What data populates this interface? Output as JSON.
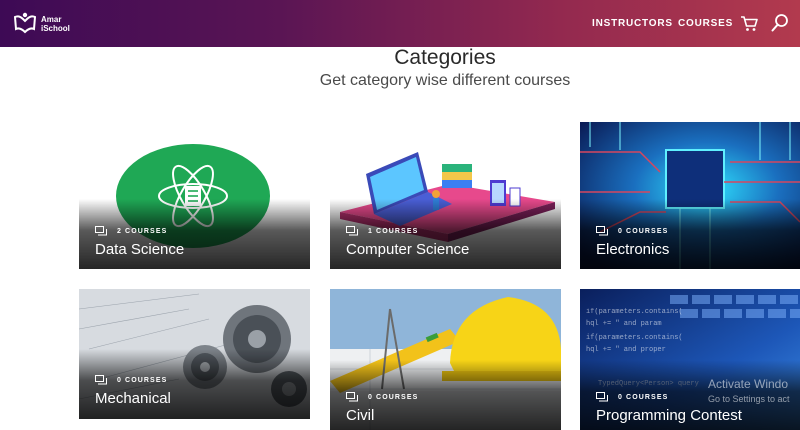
{
  "brand": {
    "line1": "Amar",
    "line2": "iSchool"
  },
  "nav": {
    "instructors": "INSTRUCTORS",
    "courses": "COURSES"
  },
  "icons": {
    "cart": "cart-icon",
    "search": "search-icon",
    "courses": "book-stack-icon"
  },
  "colors": {
    "header_start": "#3d0a55",
    "header_end": "#b23a4e",
    "science_green": "#1fa855"
  },
  "section": {
    "title": "Categories",
    "subtitle": "Get category wise different courses"
  },
  "categories": [
    {
      "name": "Data Science",
      "count": "2 COURSES"
    },
    {
      "name": "Computer Science",
      "count": "1 COURSES"
    },
    {
      "name": "Electronics",
      "count": "0 COURSES"
    },
    {
      "name": "Mechanical",
      "count": "0 COURSES"
    },
    {
      "name": "Civil",
      "count": "0 COURSES"
    },
    {
      "name": "Programming Contest",
      "count": "0 COURSES"
    }
  ],
  "watermark": {
    "title": "Activate Windo",
    "sub": "Go to Settings to act"
  }
}
